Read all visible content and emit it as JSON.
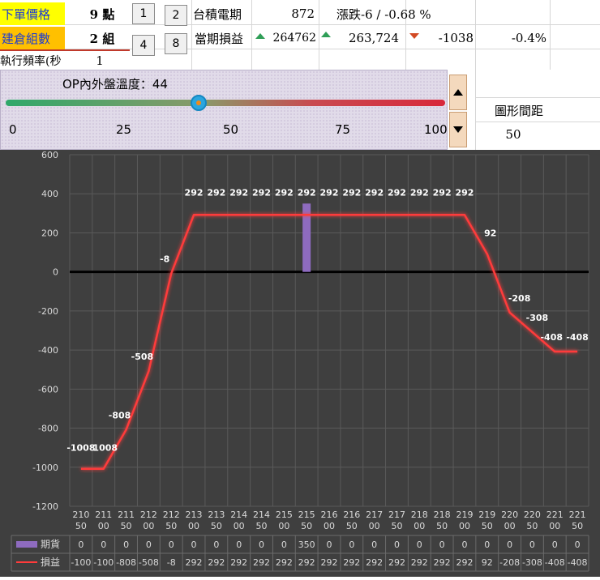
{
  "sheet": {
    "order_price_label": "下單價格",
    "order_price_value": "9 點",
    "position_label": "建倉組數",
    "position_value": "2 組",
    "freq_label": "執行頻率(秒",
    "freq_value": "1",
    "btn_1": "1",
    "btn_2": "2",
    "btn_4": "4",
    "btn_8": "8",
    "tsmc_label": "台積電期",
    "tsmc_value": "872",
    "change_text": "漲跌-6 / -0.68 %",
    "pnl_label": "當期損益",
    "pnl_value1": "264762",
    "pnl_value2": "263,724",
    "pnl_diff": "-1038",
    "pnl_pct": "-0.4%",
    "chart_gap_label": "圖形間距",
    "chart_gap_value": "50"
  },
  "slider": {
    "title": "OP內外盤溫度：44",
    "value": 44,
    "min": 0,
    "max": 100,
    "ticks": [
      "0",
      "25",
      "50",
      "75",
      "100"
    ]
  },
  "colors": {
    "chart_bg": "#3f3f3f",
    "line": "#ff3b3b",
    "bar": "#8e6bbf",
    "label": "#ffffff",
    "gradient_start": "#2fa86a",
    "gradient_end": "#d8283a"
  },
  "chart_data": {
    "type": "line",
    "ylim": [
      -1200,
      600
    ],
    "yticks": [
      "600",
      "400",
      "200",
      "0",
      "-200",
      "-400",
      "-600",
      "-800",
      "-1000",
      "-1200"
    ],
    "categories": [
      "21050",
      "21100",
      "21150",
      "21200",
      "21250",
      "21300",
      "21350",
      "21400",
      "21450",
      "21500",
      "21550",
      "21600",
      "21650",
      "21700",
      "21750",
      "21800",
      "21850",
      "21900",
      "21950",
      "22000",
      "22050",
      "22100",
      "22150"
    ],
    "category_lines": [
      [
        "210",
        "50"
      ],
      [
        "211",
        "00"
      ],
      [
        "211",
        "50"
      ],
      [
        "212",
        "00"
      ],
      [
        "212",
        "50"
      ],
      [
        "213",
        "00"
      ],
      [
        "213",
        "50"
      ],
      [
        "214",
        "00"
      ],
      [
        "214",
        "50"
      ],
      [
        "215",
        "00"
      ],
      [
        "215",
        "50"
      ],
      [
        "216",
        "00"
      ],
      [
        "216",
        "50"
      ],
      [
        "217",
        "00"
      ],
      [
        "217",
        "50"
      ],
      [
        "218",
        "00"
      ],
      [
        "218",
        "50"
      ],
      [
        "219",
        "00"
      ],
      [
        "219",
        "50"
      ],
      [
        "220",
        "00"
      ],
      [
        "220",
        "50"
      ],
      [
        "221",
        "00"
      ],
      [
        "221",
        "50"
      ]
    ],
    "series": [
      {
        "name": "期貨",
        "type": "bar",
        "values": [
          0,
          0,
          0,
          0,
          0,
          0,
          0,
          0,
          0,
          0,
          350,
          0,
          0,
          0,
          0,
          0,
          0,
          0,
          0,
          0,
          0,
          0,
          0
        ],
        "table": [
          "0",
          "0",
          "0",
          "0",
          "0",
          "0",
          "0",
          "0",
          "0",
          "0",
          "350",
          "0",
          "0",
          "0",
          "0",
          "0",
          "0",
          "0",
          "0",
          "0",
          "0",
          "0",
          "0"
        ]
      },
      {
        "name": "損益",
        "type": "line",
        "values": [
          -1008,
          -1008,
          -808,
          -508,
          -8,
          292,
          292,
          292,
          292,
          292,
          292,
          292,
          292,
          292,
          292,
          292,
          292,
          292,
          92,
          -208,
          -308,
          -408,
          -408
        ],
        "labels": [
          "-1008",
          "1008",
          "-808",
          "-508",
          "-8",
          "292",
          "292",
          "292",
          "292",
          "292",
          "292",
          "292",
          "292",
          "292",
          "292",
          "292",
          "292",
          "292",
          "92",
          "-208",
          "-308",
          "-408",
          "-408"
        ],
        "table": [
          "-100",
          "-100",
          "-808",
          "-508",
          "-8",
          "292",
          "292",
          "292",
          "292",
          "292",
          "292",
          "292",
          "292",
          "292",
          "292",
          "292",
          "292",
          "292",
          "92",
          "-208",
          "-308",
          "-408",
          "-408"
        ]
      }
    ]
  }
}
